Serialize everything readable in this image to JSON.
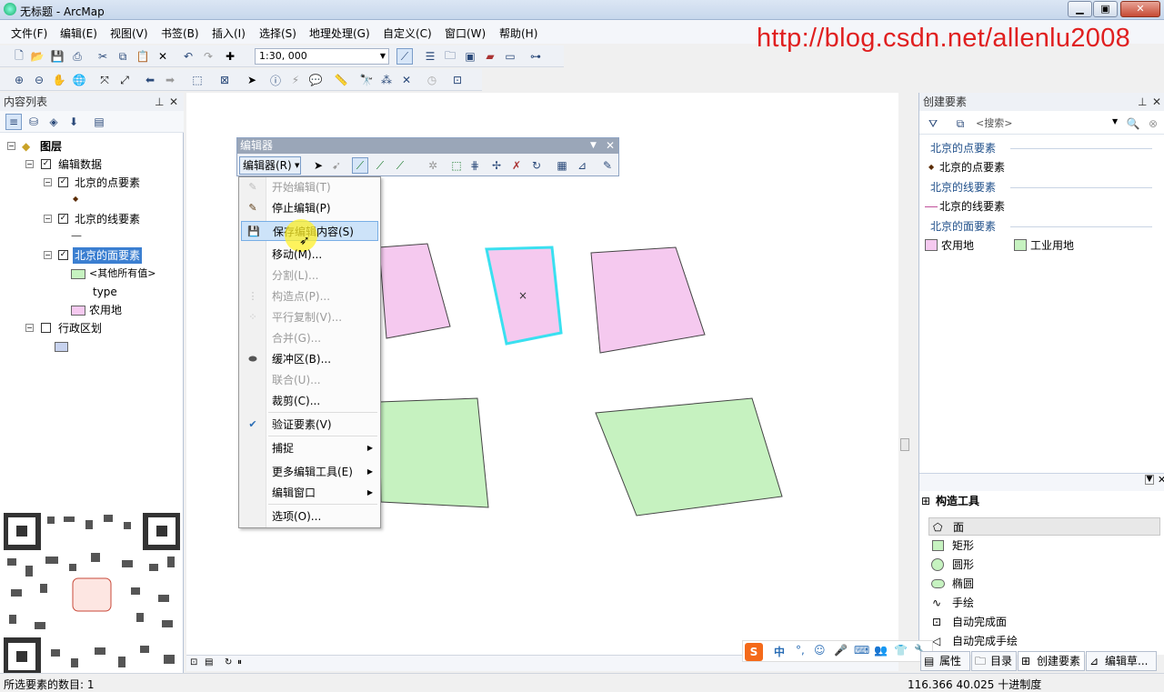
{
  "window": {
    "title": "无标题 - ArcMap",
    "min": "▁",
    "max": "▣",
    "close": "✕"
  },
  "menu": [
    "文件(F)",
    "编辑(E)",
    "视图(V)",
    "书签(B)",
    "插入(I)",
    "选择(S)",
    "地理处理(G)",
    "自定义(C)",
    "窗口(W)",
    "帮助(H)"
  ],
  "watermark": "http://blog.csdn.net/allenlu2008",
  "toolbar": {
    "scale": "1:30, 000"
  },
  "toc": {
    "title": "内容列表",
    "root": "图层",
    "group": "编辑数据",
    "layers": [
      {
        "name": "北京的点要素",
        "symbol": "◆"
      },
      {
        "name": "北京的线要素",
        "symbol": "—"
      },
      {
        "name": "北京的面要素",
        "selected": true
      }
    ],
    "legend": {
      "other": "<其他所有值>",
      "field": "type",
      "value": "农用地"
    },
    "admin": "行政区划"
  },
  "editor": {
    "title": "编辑器",
    "button": "编辑器(R)",
    "menu": [
      {
        "label": "开始编辑(T)",
        "disabled": true,
        "icon": "start-edit-icon"
      },
      {
        "label": "停止编辑(P)",
        "disabled": false,
        "icon": "stop-edit-icon"
      },
      {
        "label": "保存编辑内容(S)",
        "disabled": false,
        "highlight": true,
        "icon": "save-edits-icon"
      },
      {
        "label": "移动(M)...",
        "disabled": false
      },
      {
        "label": "分割(L)...",
        "disabled": true
      },
      {
        "label": "构造点(P)...",
        "disabled": true,
        "icon": "construct-points-icon"
      },
      {
        "label": "平行复制(V)...",
        "disabled": true,
        "icon": "copy-parallel-icon"
      },
      {
        "label": "合并(G)...",
        "disabled": true
      },
      {
        "label": "缓冲区(B)...",
        "disabled": false,
        "icon": "buffer-icon"
      },
      {
        "label": "联合(U)...",
        "disabled": true
      },
      {
        "label": "裁剪(C)...",
        "disabled": false
      },
      {
        "label": "验证要素(V)",
        "disabled": false,
        "icon": "validate-icon"
      },
      {
        "label": "捕捉",
        "submenu": true
      },
      {
        "label": "更多编辑工具(E)",
        "submenu": true
      },
      {
        "label": "编辑窗口",
        "submenu": true
      },
      {
        "label": "选项(O)..."
      }
    ]
  },
  "create_features": {
    "title": "创建要素",
    "search_placeholder": "<搜索>",
    "groups": [
      {
        "header": "北京的点要素",
        "items": [
          {
            "label": "北京的点要素",
            "symbol": "point"
          }
        ]
      },
      {
        "header": "北京的线要素",
        "items": [
          {
            "label": "北京的线要素",
            "symbol": "line"
          }
        ]
      },
      {
        "header": "北京的面要素",
        "items": [
          {
            "label": "农用地",
            "color": "#f5c9ef"
          },
          {
            "label": "工业用地",
            "color": "#c6f2c0"
          }
        ]
      }
    ]
  },
  "construct_tools": {
    "title": "构造工具",
    "items": [
      "面",
      "矩形",
      "圆形",
      "椭圆",
      "手绘",
      "自动完成面",
      "自动完成手绘"
    ]
  },
  "bottom_tabs": [
    "属性",
    "目录",
    "创建要素",
    "编辑草..."
  ],
  "ime": {
    "lang": "中"
  },
  "status": {
    "left": "所选要素的数目: 1",
    "coords": "116.366  40.025 十进制度"
  },
  "colors": {
    "farmland": "#f5c9ef",
    "industrial": "#c6f2c0",
    "selection": "#3ae0f0",
    "highlight": "#cde3f9"
  }
}
